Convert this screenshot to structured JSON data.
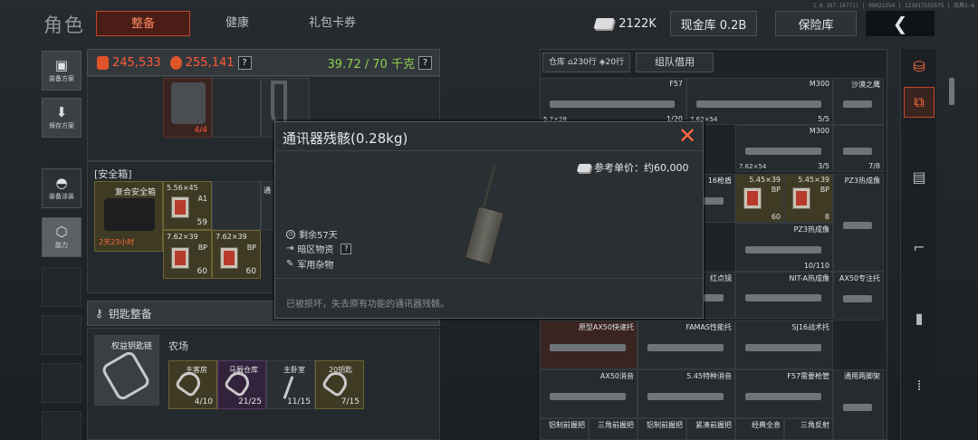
{
  "header": {
    "title": "角色",
    "tabs": [
      {
        "label": "整备",
        "active": true
      },
      {
        "label": "健康",
        "active": false
      },
      {
        "label": "礼包卡券",
        "active": false
      }
    ],
    "build_info": "1.0.167.167(1) | 09021254 | 123917555575 | 品质1-6",
    "currency": "2122K",
    "cash_store": "现金库 0.2B",
    "safe_button": "保险库",
    "back_icon": "chevron-left-icon"
  },
  "left_sidebar": [
    {
      "label": "装备方案",
      "icon": "backpack-icon"
    },
    {
      "label": "保存方案",
      "icon": "download-icon"
    },
    {
      "label": "装备涂装",
      "icon": "helmet-icon"
    },
    {
      "label": "能力",
      "icon": "ability-icon"
    }
  ],
  "stats": {
    "value_a": "245,533",
    "value_b": "255,141",
    "weight": "39.72 / 70 千克",
    "help": "?"
  },
  "equipment": {
    "top_slot_count": "4/4"
  },
  "safe_box": {
    "title": "安全箱",
    "container_name": "复合安全箱",
    "container_timer": "2天23小时",
    "items": [
      {
        "name": "5.56×45",
        "grade": "A1",
        "count": "59"
      },
      {
        "name": "7.62×39",
        "grade": "BP",
        "count": "60"
      },
      {
        "name": "7.62×39",
        "grade": "BP",
        "count": "60"
      }
    ],
    "partial_label": "通"
  },
  "key_section": {
    "title": "钥匙整备",
    "chain_name": "权益钥匙链",
    "area": "农场",
    "keys": [
      {
        "name": "主客房",
        "count": "4/10"
      },
      {
        "name": "马厩仓库",
        "count": "21/25"
      },
      {
        "name": "主卧室",
        "count": "11/15"
      },
      {
        "name": "20钥匙",
        "count": "7/15"
      }
    ]
  },
  "inventory": {
    "tabs": [
      "仓库",
      "230行",
      "20行",
      "组队借用"
    ],
    "cells": [
      {
        "name": "F57",
        "bl": "5.7×28",
        "br": "1/20"
      },
      {
        "name": "M300",
        "bl": "7.62×54",
        "br": "5/5"
      },
      {
        "name": "沙漠之鹰",
        "bl": "",
        "br": ""
      },
      {
        "name": "F57",
        "bl": "",
        "br": "7/10"
      },
      {
        "name": "M300",
        "bl": "7.62×54",
        "br": "3/5"
      },
      {
        "name": "",
        "bl": "",
        "br": "7/8"
      },
      {
        "name": "16枪盾",
        "bl": "",
        "br": ""
      },
      {
        "name": "5.45×39",
        "grade": "BP",
        "br": "60"
      },
      {
        "name": "5.45×39",
        "grade": "BP",
        "br": "8"
      },
      {
        "name": "PZ3热成像",
        "bl": "",
        "br": ""
      },
      {
        "name": "PZ3热成像",
        "bl": "",
        "br": "10/110"
      },
      {
        "name": "红点镜",
        "bl": "",
        "br": ""
      },
      {
        "name": "NIT-A热成像",
        "bl": "",
        "br": ""
      },
      {
        "name": "AX50专注托",
        "bl": "",
        "br": ""
      },
      {
        "name": "原型AX50快速托",
        "bl": "",
        "br": ""
      },
      {
        "name": "FAMAS性能托",
        "bl": "",
        "br": ""
      },
      {
        "name": "SJ16战术托",
        "bl": "",
        "br": ""
      },
      {
        "name": "AX50消音",
        "bl": "",
        "br": ""
      },
      {
        "name": "5.45特种消音",
        "bl": "",
        "br": ""
      },
      {
        "name": "F57需要枪管",
        "bl": "",
        "br": ""
      },
      {
        "name": "通用两脚架",
        "bl": "",
        "br": ""
      },
      {
        "name": "铝制前握把",
        "bl": "",
        "br": ""
      },
      {
        "name": "三角前握把",
        "bl": "",
        "br": ""
      },
      {
        "name": "铝制前握把",
        "bl": "",
        "br": ""
      },
      {
        "name": "紧凑前握把",
        "bl": "",
        "br": ""
      },
      {
        "name": "经典全息",
        "bl": "",
        "br": ""
      },
      {
        "name": "三角反射",
        "bl": "",
        "br": ""
      }
    ]
  },
  "right_strip_icons": [
    "stack-icon",
    "layers-icon",
    "vest-icon",
    "rifle-icon",
    "magazine-icon",
    "ammo-icon"
  ],
  "modal": {
    "title": "通讯器残骸(0.28kg)",
    "price_label": "参考单价：约60,000",
    "remaining": "剩余57天",
    "market": "暗区物资",
    "category": "军用杂物",
    "description": "已被损坏，失去原有功能的通讯器残骸。",
    "help": "?"
  },
  "colors": {
    "accent": "#ff6a3d",
    "weight_green": "#8fd14f",
    "panel": "#24292d"
  }
}
